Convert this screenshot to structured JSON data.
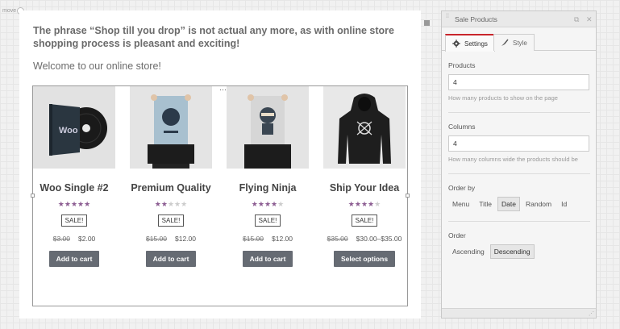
{
  "move_label": "move",
  "intro": {
    "bold_text": "The phrase “Shop till you drop” is not actual any more, as with online store shopping process is pleasant and exciting!",
    "welcome": "Welcome to our online store!"
  },
  "products": [
    {
      "title": "Woo Single #2",
      "rating": 4.5,
      "badge": "SALE!",
      "old_price": "$3.00",
      "price": "$2.00",
      "button": "Add to cart",
      "image": "vinyl-record-image"
    },
    {
      "title": "Premium Quality",
      "rating": 2,
      "badge": "SALE!",
      "old_price": "$15.00",
      "price": "$12.00",
      "button": "Add to cart",
      "image": "poster-image"
    },
    {
      "title": "Flying Ninja",
      "rating": 4,
      "badge": "SALE!",
      "old_price": "$15.00",
      "price": "$12.00",
      "button": "Add to cart",
      "image": "ninja-poster-image"
    },
    {
      "title": "Ship Your Idea",
      "rating": 4,
      "badge": "SALE!",
      "old_price": "$35.00",
      "price": "$30.00–$35.00",
      "button": "Select options",
      "image": "hoodie-image"
    }
  ],
  "panel": {
    "title": "Sale Products",
    "tabs": [
      {
        "label": "Settings",
        "icon": "gear-icon",
        "active": true
      },
      {
        "label": "Style",
        "icon": "brush-icon",
        "active": false
      }
    ],
    "products_field": {
      "label": "Products",
      "value": "4",
      "help": "How many products to show on the page"
    },
    "columns_field": {
      "label": "Columns",
      "value": "4",
      "help": "How many columns wide the products should be"
    },
    "order_by": {
      "label": "Order by",
      "options": [
        "Menu",
        "Title",
        "Date",
        "Random",
        "Id"
      ],
      "selected": "Date"
    },
    "order": {
      "label": "Order",
      "options": [
        "Ascending",
        "Descending"
      ],
      "selected": "Descending"
    }
  },
  "colors": {
    "accent": "#c9252c",
    "star": "#8c5d92",
    "button": "#666b73"
  }
}
